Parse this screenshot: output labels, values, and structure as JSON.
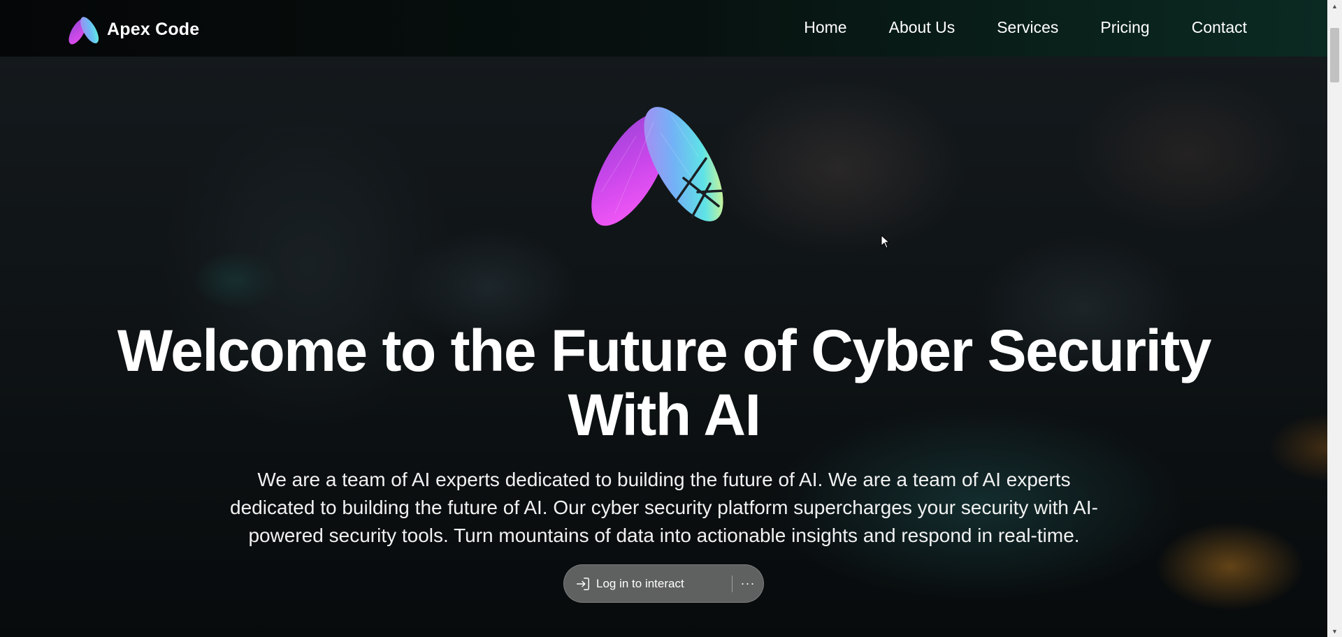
{
  "brand": {
    "name": "Apex Code"
  },
  "nav": {
    "items": [
      {
        "label": "Home"
      },
      {
        "label": "About Us"
      },
      {
        "label": "Services"
      },
      {
        "label": "Pricing"
      },
      {
        "label": "Contact"
      }
    ]
  },
  "hero": {
    "title_lines": [
      "Welcome to the Future of Cyber Security",
      "With AI"
    ],
    "description_lines": [
      "We are a team of AI experts dedicated to building the future of AI. We are a team of AI experts",
      "dedicated to building the future of AI. Our cyber security platform supercharges your security with AI-",
      "powered security tools. Turn mountains of data into actionable insights and respond in real-time."
    ]
  },
  "login_widget": {
    "label": "Log in to interact",
    "more_label": "···",
    "icon": "login-arrow-icon"
  },
  "colors": {
    "logo_magenta": "#c43ee8",
    "logo_blue": "#7aa9f2",
    "logo_cyan": "#5fe3e6",
    "logo_lime": "#d8f58a",
    "nav_gradient_end": "#0b2a22"
  },
  "scrollbar": {
    "up_icon": "▲",
    "down_icon": "▼"
  }
}
